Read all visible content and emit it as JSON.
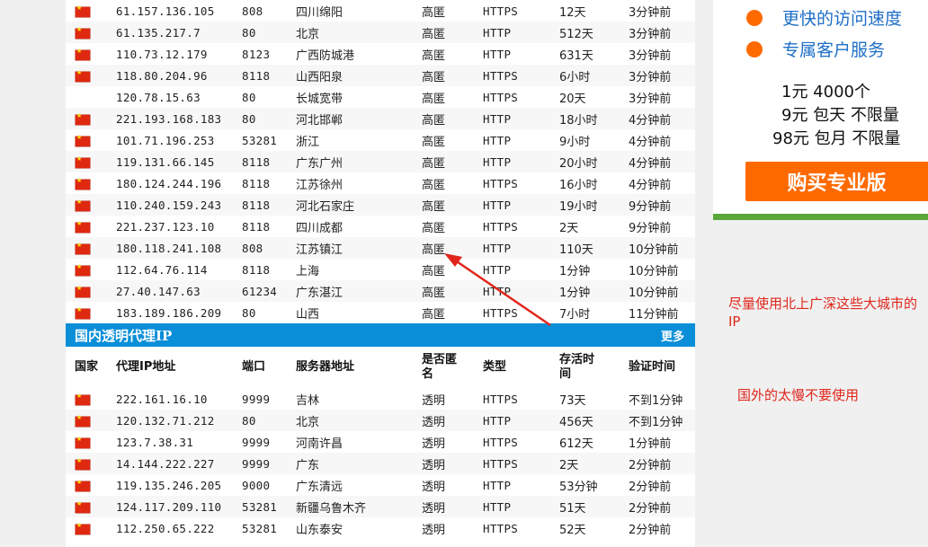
{
  "high_anon_rows": [
    {
      "ip": "61.157.136.105",
      "port": "808",
      "location": "四川绵阳",
      "anonymity": "高匿",
      "type": "HTTPS",
      "alive": "12天",
      "verified": "3分钟前"
    },
    {
      "ip": "61.135.217.7",
      "port": "80",
      "location": "北京",
      "anonymity": "高匿",
      "type": "HTTP",
      "alive": "512天",
      "verified": "3分钟前"
    },
    {
      "ip": "110.73.12.179",
      "port": "8123",
      "location": "广西防城港",
      "anonymity": "高匿",
      "type": "HTTP",
      "alive": "631天",
      "verified": "3分钟前"
    },
    {
      "ip": "118.80.204.96",
      "port": "8118",
      "location": "山西阳泉",
      "anonymity": "高匿",
      "type": "HTTPS",
      "alive": "6小时",
      "verified": "3分钟前"
    },
    {
      "ip": "120.78.15.63",
      "port": "80",
      "location": "长城宽带",
      "anonymity": "高匿",
      "type": "HTTPS",
      "alive": "20天",
      "verified": "3分钟前",
      "no_flag": true
    },
    {
      "ip": "221.193.168.183",
      "port": "80",
      "location": "河北邯郸",
      "anonymity": "高匿",
      "type": "HTTP",
      "alive": "18小时",
      "verified": "4分钟前"
    },
    {
      "ip": "101.71.196.253",
      "port": "53281",
      "location": "浙江",
      "anonymity": "高匿",
      "type": "HTTP",
      "alive": "9小时",
      "verified": "4分钟前"
    },
    {
      "ip": "119.131.66.145",
      "port": "8118",
      "location": "广东广州",
      "anonymity": "高匿",
      "type": "HTTP",
      "alive": "20小时",
      "verified": "4分钟前"
    },
    {
      "ip": "180.124.244.196",
      "port": "8118",
      "location": "江苏徐州",
      "anonymity": "高匿",
      "type": "HTTPS",
      "alive": "16小时",
      "verified": "4分钟前"
    },
    {
      "ip": "110.240.159.243",
      "port": "8118",
      "location": "河北石家庄",
      "anonymity": "高匿",
      "type": "HTTP",
      "alive": "19小时",
      "verified": "9分钟前"
    },
    {
      "ip": "221.237.123.10",
      "port": "8118",
      "location": "四川成都",
      "anonymity": "高匿",
      "type": "HTTPS",
      "alive": "2天",
      "verified": "9分钟前"
    },
    {
      "ip": "180.118.241.108",
      "port": "808",
      "location": "江苏镇江",
      "anonymity": "高匿",
      "type": "HTTP",
      "alive": "110天",
      "verified": "10分钟前"
    },
    {
      "ip": "112.64.76.114",
      "port": "8118",
      "location": "上海",
      "anonymity": "高匿",
      "type": "HTTP",
      "alive": "1分钟",
      "verified": "10分钟前"
    },
    {
      "ip": "27.40.147.63",
      "port": "61234",
      "location": "广东湛江",
      "anonymity": "高匿",
      "type": "HTTP",
      "alive": "1分钟",
      "verified": "10分钟前"
    },
    {
      "ip": "183.189.186.209",
      "port": "80",
      "location": "山西",
      "anonymity": "高匿",
      "type": "HTTPS",
      "alive": "7小时",
      "verified": "11分钟前"
    }
  ],
  "transparent_section": {
    "title": "国内透明代理IP",
    "more": "更多",
    "headers": {
      "country": "国家",
      "ip": "代理IP地址",
      "port": "端口",
      "server": "服务器地址",
      "anonymity": "是否匿名",
      "type": "类型",
      "alive": "存活时间",
      "verified": "验证时间"
    },
    "rows": [
      {
        "ip": "222.161.16.10",
        "port": "9999",
        "location": "吉林",
        "anonymity": "透明",
        "type": "HTTPS",
        "alive": "73天",
        "verified": "不到1分钟"
      },
      {
        "ip": "120.132.71.212",
        "port": "80",
        "location": "北京",
        "anonymity": "透明",
        "type": "HTTP",
        "alive": "456天",
        "verified": "不到1分钟"
      },
      {
        "ip": "123.7.38.31",
        "port": "9999",
        "location": "河南许昌",
        "anonymity": "透明",
        "type": "HTTPS",
        "alive": "612天",
        "verified": "1分钟前"
      },
      {
        "ip": "14.144.222.227",
        "port": "9999",
        "location": "广东",
        "anonymity": "透明",
        "type": "HTTPS",
        "alive": "2天",
        "verified": "2分钟前"
      },
      {
        "ip": "119.135.246.205",
        "port": "9000",
        "location": "广东清远",
        "anonymity": "透明",
        "type": "HTTP",
        "alive": "53分钟",
        "verified": "2分钟前"
      },
      {
        "ip": "124.117.209.110",
        "port": "53281",
        "location": "新疆乌鲁木齐",
        "anonymity": "透明",
        "type": "HTTP",
        "alive": "51天",
        "verified": "2分钟前"
      },
      {
        "ip": "112.250.65.222",
        "port": "53281",
        "location": "山东泰安",
        "anonymity": "透明",
        "type": "HTTPS",
        "alive": "52天",
        "verified": "2分钟前"
      }
    ]
  },
  "sidebar": {
    "features": [
      "更快的访问速度",
      "专属客户服务"
    ],
    "prices": [
      "1元 4000个",
      "9元 包天 不限量",
      "98元 包月 不限量"
    ],
    "buy_button": "购买专业版"
  },
  "annotations": {
    "note1": "尽量使用北上广深这些大城市的IP",
    "note2": "国外的太慢不要使用"
  },
  "colors": {
    "header_blue": "#0a8ed8",
    "accent_orange": "#ff6a00",
    "annotation_red": "#e0261c",
    "link_blue": "#1e6fc7",
    "green_bar": "#5aa73a"
  }
}
